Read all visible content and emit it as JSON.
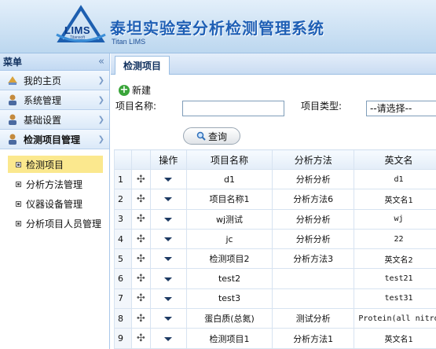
{
  "header": {
    "logo_text": "LIMS",
    "logo_sub": "Titansoft",
    "title": "泰坦实验室分析检测管理系统",
    "subtitle": "Titan LIMS"
  },
  "sidebar": {
    "title": "菜单",
    "collapse_icon": "«",
    "items": [
      {
        "label": "我的主页",
        "icon": "home-icon"
      },
      {
        "label": "系统管理",
        "icon": "user-icon"
      },
      {
        "label": "基础设置",
        "icon": "user-icon"
      },
      {
        "label": "检测项目管理",
        "icon": "user-icon"
      }
    ],
    "sub_items": [
      {
        "label": "检测项目"
      },
      {
        "label": "分析方法管理"
      },
      {
        "label": "仪器设备管理"
      },
      {
        "label": "分析项目人员管理"
      }
    ]
  },
  "main": {
    "tab_label": "检测项目",
    "add_label": "新建",
    "name_label": "项目名称:",
    "name_value": "",
    "type_label": "项目类型:",
    "type_selected": "--请选择--",
    "query_label": "查询"
  },
  "table": {
    "columns": [
      "",
      "",
      "操作",
      "项目名称",
      "分析方法",
      "英文名"
    ],
    "rows": [
      {
        "num": "1",
        "name": "d1",
        "method": "分析分析",
        "en": "d1"
      },
      {
        "num": "2",
        "name": "项目名称1",
        "method": "分析方法6",
        "en": "英文名1"
      },
      {
        "num": "3",
        "name": "wj测试",
        "method": "分析分析",
        "en": "wj"
      },
      {
        "num": "4",
        "name": "jc",
        "method": "分析分析",
        "en": "22"
      },
      {
        "num": "5",
        "name": "检测项目2",
        "method": "分析方法3",
        "en": "英文名2"
      },
      {
        "num": "6",
        "name": "test2",
        "method": "",
        "en": "test21"
      },
      {
        "num": "7",
        "name": "test3",
        "method": "",
        "en": "test31"
      },
      {
        "num": "8",
        "name": "蛋白质(总氮)",
        "method": "测试分析",
        "en": "Protein(all nitro"
      },
      {
        "num": "9",
        "name": "检测项目1",
        "method": "分析方法1",
        "en": "英文名1"
      }
    ]
  },
  "colors": {
    "accent": "#1e5fb5",
    "active_highlight": "#fbe88e"
  }
}
